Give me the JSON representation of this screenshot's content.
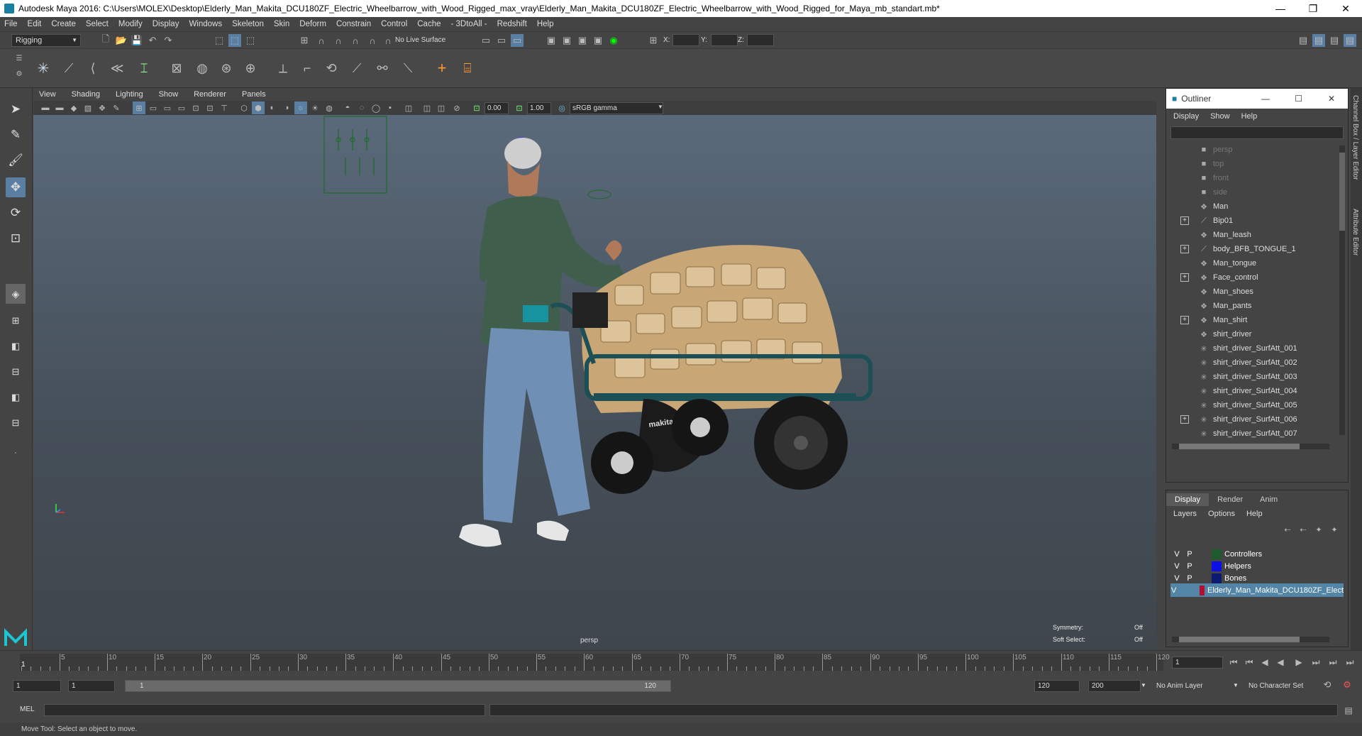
{
  "window": {
    "title": "Autodesk Maya 2016: C:\\Users\\MOLEX\\Desktop\\Elderly_Man_Makita_DCU180ZF_Electric_Wheelbarrow_with_Wood_Rigged_max_vray\\Elderly_Man_Makita_DCU180ZF_Electric_Wheelbarrow_with_Wood_Rigged_for_Maya_mb_standart.mb*"
  },
  "menu": [
    "File",
    "Edit",
    "Create",
    "Select",
    "Modify",
    "Display",
    "Windows",
    "Skeleton",
    "Skin",
    "Deform",
    "Constrain",
    "Control",
    "Cache",
    "- 3DtoAll -",
    "Redshift",
    "Help"
  ],
  "status": {
    "mode": "Rigging",
    "live_surface": "No Live Surface",
    "x_label": "X:",
    "y_label": "Y:",
    "z_label": "Z:"
  },
  "viewport": {
    "menu": [
      "View",
      "Shading",
      "Lighting",
      "Show",
      "Renderer",
      "Panels"
    ],
    "exposure": "0.00",
    "gamma": "1.00",
    "color_space": "sRGB gamma",
    "camera": "persp",
    "symmetry_label": "Symmetry:",
    "symmetry_value": "Off",
    "soft_select_label": "Soft Select:",
    "soft_select_value": "Off",
    "brand": "makita"
  },
  "outliner": {
    "title": "Outliner",
    "menu": [
      "Display",
      "Show",
      "Help"
    ],
    "items": [
      {
        "name": "persp",
        "icon": "camera-icon",
        "expand": false,
        "dim": true
      },
      {
        "name": "top",
        "icon": "camera-icon",
        "expand": false,
        "dim": true
      },
      {
        "name": "front",
        "icon": "camera-icon",
        "expand": false,
        "dim": true
      },
      {
        "name": "side",
        "icon": "camera-icon",
        "expand": false,
        "dim": true
      },
      {
        "name": "Man",
        "icon": "mesh-icon",
        "expand": false,
        "dim": false
      },
      {
        "name": "Bip01",
        "icon": "joint-icon",
        "expand": true,
        "dim": false
      },
      {
        "name": "Man_leash",
        "icon": "mesh-icon",
        "expand": false,
        "dim": false
      },
      {
        "name": "body_BFB_TONGUE_1",
        "icon": "joint-icon",
        "expand": true,
        "dim": false
      },
      {
        "name": "Man_tongue",
        "icon": "mesh-icon",
        "expand": false,
        "dim": false
      },
      {
        "name": "Face_control",
        "icon": "mesh-icon",
        "expand": true,
        "dim": false
      },
      {
        "name": "Man_shoes",
        "icon": "mesh-icon",
        "expand": false,
        "dim": false
      },
      {
        "name": "Man_pants",
        "icon": "mesh-icon",
        "expand": false,
        "dim": false
      },
      {
        "name": "Man_shirt",
        "icon": "mesh-icon",
        "expand": true,
        "dim": false
      },
      {
        "name": "shirt_driver",
        "icon": "mesh-icon",
        "expand": false,
        "dim": false
      },
      {
        "name": "shirt_driver_SurfAtt_001",
        "icon": "locator-icon",
        "expand": false,
        "dim": false
      },
      {
        "name": "shirt_driver_SurfAtt_002",
        "icon": "locator-icon",
        "expand": false,
        "dim": false
      },
      {
        "name": "shirt_driver_SurfAtt_003",
        "icon": "locator-icon",
        "expand": false,
        "dim": false
      },
      {
        "name": "shirt_driver_SurfAtt_004",
        "icon": "locator-icon",
        "expand": false,
        "dim": false
      },
      {
        "name": "shirt_driver_SurfAtt_005",
        "icon": "locator-icon",
        "expand": false,
        "dim": false
      },
      {
        "name": "shirt_driver_SurfAtt_006",
        "icon": "locator-icon",
        "expand": true,
        "dim": false
      },
      {
        "name": "shirt_driver_SurfAtt_007",
        "icon": "locator-icon",
        "expand": false,
        "dim": false
      }
    ]
  },
  "layers": {
    "tabs": [
      "Display",
      "Render",
      "Anim"
    ],
    "active_tab": "Display",
    "menu": [
      "Layers",
      "Options",
      "Help"
    ],
    "rows": [
      {
        "v": "V",
        "p": "P",
        "color": "#1e5a2c",
        "name": "Controllers"
      },
      {
        "v": "V",
        "p": "P",
        "color": "#0a10e6",
        "name": "Helpers"
      },
      {
        "v": "V",
        "p": "P",
        "color": "#0c1a70",
        "name": "Bones"
      },
      {
        "v": "V",
        "p": "",
        "color": "#b21030",
        "name": "Elderly_Man_Makita_DCU180ZF_Elect"
      }
    ]
  },
  "right_tabs": [
    "Channel Box / Layer Editor",
    "Attribute Editor"
  ],
  "timeline": {
    "ticks": [
      "5",
      "10",
      "15",
      "20",
      "25",
      "30",
      "35",
      "40",
      "45",
      "50",
      "55",
      "60",
      "65",
      "70",
      "75",
      "80",
      "85",
      "90",
      "95",
      "100",
      "105",
      "110",
      "115",
      "120"
    ],
    "current_frame": "1",
    "range_start_num": "1"
  },
  "range": {
    "start": "1",
    "playback_start": "1",
    "slider_start": "1",
    "slider_end": "120",
    "playback_end": "120",
    "end": "200",
    "anim_layer": "No Anim Layer",
    "char_set": "No Character Set"
  },
  "command": {
    "label": "MEL"
  },
  "help": {
    "text": "Move Tool: Select an object to move."
  }
}
